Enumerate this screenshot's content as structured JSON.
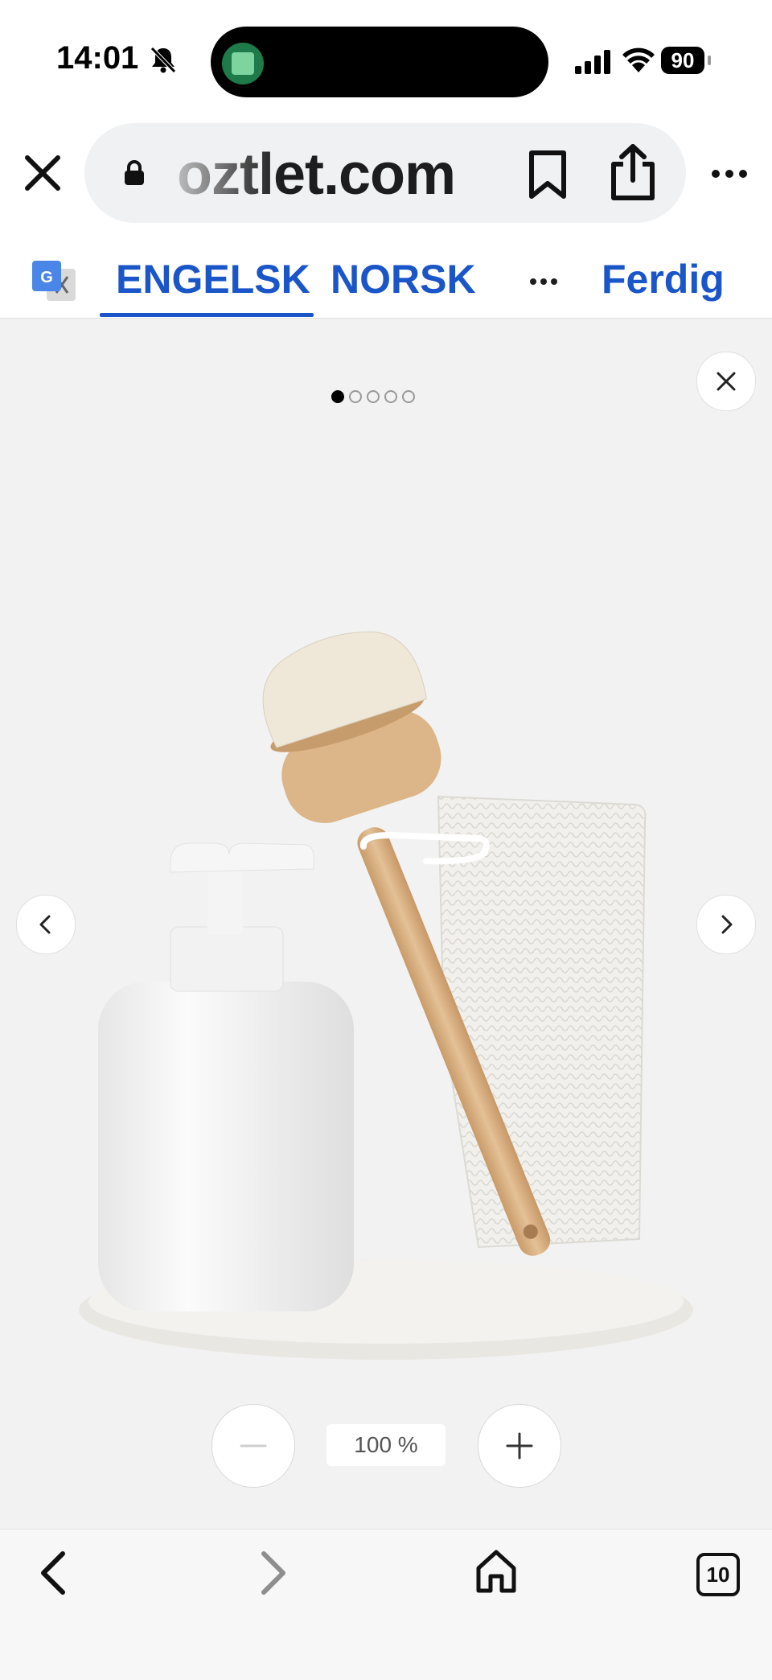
{
  "status_bar": {
    "time": "14:01",
    "battery": "90",
    "icons": [
      "bell-slash-icon",
      "signal-icon",
      "wifi-icon",
      "battery-icon"
    ]
  },
  "browser": {
    "url": "oztlet.com",
    "icons": [
      "close-icon",
      "lock-icon",
      "bookmark-icon",
      "share-icon",
      "more-icon"
    ]
  },
  "translate_bar": {
    "lang_source": "ENGELSK",
    "lang_target": "NORSK",
    "done_label": "Ferdig",
    "accent_color": "#1a56c8",
    "icons": [
      "google-translate-icon",
      "more-icon"
    ]
  },
  "gallery": {
    "page_count": 5,
    "current_page": 1,
    "zoom_level": "100 %",
    "product_image": "dish-brush-soap-dispenser-towel-tray",
    "icons": [
      "close-icon",
      "chevron-left-icon",
      "chevron-right-icon",
      "minus-icon",
      "plus-icon"
    ]
  },
  "bottom_bar": {
    "tab_count": "10",
    "icons": [
      "back-icon",
      "forward-icon",
      "home-icon",
      "tabs-icon"
    ]
  }
}
